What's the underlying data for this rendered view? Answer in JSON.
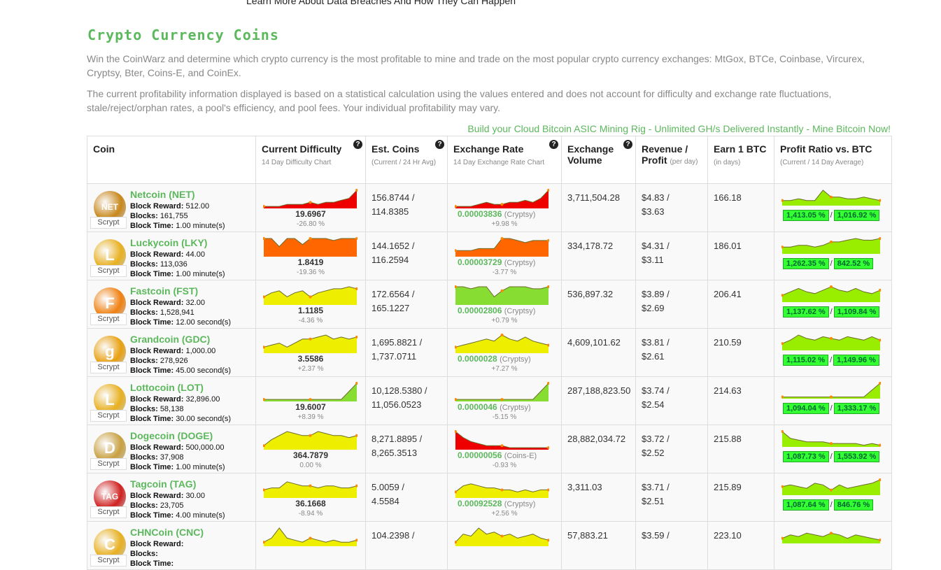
{
  "top_note": "Learn More About Data Breaches And How They Can Happen",
  "page_title": "Crypto Currency Coins",
  "intro1": "Win the CoinWarz and determine which crypto currency is the most profitable to mine and trade on the most popular crypto currency exchanges: MtGox, BTCe, Coinbase, Vircurex, Cryptsy, Bter, Coins-E, and CoinEx.",
  "intro2": "The current profitability information displayed is based on a statistical calculation using the values entered and does not account for difficulty and exchange rate fluctuations, stale/reject/orphan rates, a pool's efficiency, and pool fees. Your individual profitability may vary.",
  "promo_link": "Build your Cloud Bitcoin ASIC Mining Rig - Unlimited GH/s Delivered Instantly - Mine Bitcoin Now!",
  "headers": {
    "coin": "Coin",
    "difficulty": "Current Difficulty",
    "difficulty_sub": "14 Day Difficulty Chart",
    "est": "Est. Coins",
    "est_sub": "(Current / 24 Hr Avg)",
    "rate": "Exchange Rate",
    "rate_sub": "14 Day Exchange Rate Chart",
    "volume": "Exchange Volume",
    "revenue": "Revenue / Profit",
    "revenue_sub": "(per day)",
    "earn": "Earn 1 BTC",
    "earn_sub": "(in days)",
    "ratio": "Profit Ratio vs. BTC",
    "ratio_sub": "(Current / 14 Day Average)",
    "help": "?"
  },
  "labels": {
    "block_reward": "Block Reward:",
    "blocks": "Blocks:",
    "block_time": "Block Time:",
    "slash": "/"
  },
  "coins": [
    {
      "name": "Netcoin (NET)",
      "reward": "512.00",
      "blocks": "161,755",
      "time": "1.00 minute(s)",
      "algo": "Scrypt",
      "logo_color": "#c8871a",
      "logo_char": "NET",
      "difficulty": "19.6967",
      "diff_pct": "-26.80 %",
      "est_cur": "156.8744 /",
      "est_avg": "114.8385",
      "rate": "0.00003836",
      "exchange": "(Cryptsy)",
      "rate_pct": "+9.98 %",
      "volume": "3,711,504.28",
      "revenue": "$4.83 /",
      "profit": "$3.63",
      "earn": "166.18",
      "ratio_cur": "1,413.05 %",
      "ratio_avg": "1,016.92 %",
      "diff_color": "#e00",
      "rate_color": "#e00",
      "diff_shape": [
        1,
        1,
        1,
        2,
        2,
        2,
        3,
        2,
        3,
        3,
        4,
        5,
        9
      ],
      "rate_shape": [
        1,
        1,
        1,
        2,
        3,
        2,
        2,
        3,
        3,
        4,
        3,
        5,
        9
      ],
      "ratio_shape": [
        3,
        3,
        4,
        3,
        3,
        9,
        5,
        5,
        4,
        4,
        5,
        4,
        3
      ]
    },
    {
      "name": "Luckycoin (LKY)",
      "reward": "44.00",
      "blocks": "113,036",
      "time": "1.00 minute(s)",
      "algo": "Scrypt",
      "logo_color": "#e8b020",
      "logo_char": "L",
      "difficulty": "1.8419",
      "diff_pct": "-19.36 %",
      "est_cur": "144.1652 /",
      "est_avg": "116.2594",
      "rate": "0.00003729",
      "exchange": "(Cryptsy)",
      "rate_pct": "-3.77 %",
      "volume": "334,178.72",
      "revenue": "$4.31 /",
      "profit": "$3.11",
      "earn": "186.01",
      "ratio_cur": "1,262.35 %",
      "ratio_avg": "842.52 %",
      "diff_color": "#f60",
      "rate_color": "#f60",
      "diff_shape": [
        9,
        9,
        5,
        9,
        9,
        6,
        9,
        9,
        9,
        8,
        9,
        9,
        9
      ],
      "rate_shape": [
        3,
        3,
        3,
        4,
        4,
        4,
        9,
        9,
        8,
        7,
        8,
        8,
        8
      ],
      "ratio_shape": [
        4,
        4,
        5,
        5,
        4,
        5,
        7,
        7,
        8,
        9,
        8,
        8,
        9
      ]
    },
    {
      "name": "Fastcoin (FST)",
      "reward": "32.00",
      "blocks": "1,528,941",
      "time": "12.00 second(s)",
      "algo": "Scrypt",
      "logo_color": "#f08010",
      "logo_char": "F",
      "difficulty": "1.1185",
      "diff_pct": "-4.36 %",
      "est_cur": "172.6564 /",
      "est_avg": "165.1227",
      "rate": "0.00002806",
      "exchange": "(Cryptsy)",
      "rate_pct": "+0.79 %",
      "volume": "536,897.32",
      "revenue": "$3.89 /",
      "profit": "$2.69",
      "earn": "206.41",
      "ratio_cur": "1,137.62 %",
      "ratio_avg": "1,109.84 %",
      "diff_color": "#ee0",
      "rate_color": "#8d3",
      "diff_shape": [
        4,
        6,
        7,
        4,
        6,
        7,
        4,
        6,
        7,
        8,
        8,
        9,
        8
      ],
      "rate_shape": [
        9,
        9,
        8,
        9,
        9,
        4,
        7,
        9,
        9,
        9,
        8,
        8,
        9
      ],
      "ratio_shape": [
        4,
        6,
        8,
        6,
        5,
        7,
        9,
        7,
        6,
        8,
        6,
        5,
        7
      ]
    },
    {
      "name": "Grandcoin (GDC)",
      "reward": "1,000.00",
      "blocks": "278,926",
      "time": "45.00 second(s)",
      "algo": "Scrypt",
      "logo_color": "#e8a010",
      "logo_char": "g",
      "difficulty": "3.5586",
      "diff_pct": "+2.37 %",
      "est_cur": "1,695.8821 /",
      "est_avg": "1,737.0711",
      "rate": "0.0000028",
      "exchange": "(Cryptsy)",
      "rate_pct": "+7.27 %",
      "volume": "4,609,101.62",
      "revenue": "$3.81 /",
      "profit": "$2.61",
      "earn": "210.59",
      "ratio_cur": "1,115.02 %",
      "ratio_avg": "1,149.96 %",
      "diff_color": "#ee0",
      "rate_color": "#ee0",
      "diff_shape": [
        3,
        4,
        5,
        3,
        5,
        7,
        7,
        8,
        9,
        7,
        8,
        7,
        8
      ],
      "rate_shape": [
        3,
        4,
        5,
        6,
        7,
        6,
        9,
        7,
        6,
        8,
        6,
        5,
        4
      ],
      "ratio_shape": [
        4,
        6,
        9,
        7,
        6,
        8,
        7,
        6,
        8,
        7,
        6,
        8,
        6
      ]
    },
    {
      "name": "Lottocoin (LOT)",
      "reward": "32,896.00",
      "blocks": "58,138",
      "time": "30.00 second(s)",
      "algo": "Scrypt",
      "logo_color": "#e8b020",
      "logo_char": "L",
      "difficulty": "19.6007",
      "diff_pct": "+8.39 %",
      "est_cur": "10,128.5380 /",
      "est_avg": "11,056.0523",
      "rate": "0.0000046",
      "exchange": "(Cryptsy)",
      "rate_pct": "-5.15 %",
      "volume": "287,188,823.50",
      "revenue": "$3.74 /",
      "profit": "$2.54",
      "earn": "214.63",
      "ratio_cur": "1,094.04 %",
      "ratio_avg": "1,333.17 %",
      "diff_color": "#8d3",
      "rate_color": "#8d3",
      "diff_shape": [
        1,
        1,
        1,
        1,
        1,
        1,
        1,
        1,
        1,
        1,
        1,
        5,
        9
      ],
      "rate_shape": [
        1,
        1,
        1,
        1,
        1,
        1,
        1,
        1,
        1,
        1,
        1,
        5,
        9
      ],
      "ratio_shape": [
        1,
        1,
        1,
        1,
        1,
        1,
        1,
        1,
        1,
        1,
        1,
        5,
        9
      ]
    },
    {
      "name": "Dogecoin (DOGE)",
      "reward": "500,000.00",
      "blocks": "37,908",
      "time": "1.00 minute(s)",
      "algo": "Scrypt",
      "logo_color": "#c8a040",
      "logo_char": "D",
      "difficulty": "364.7879",
      "diff_pct": "0.00 %",
      "est_cur": "8,271.8895 /",
      "est_avg": "8,265.3513",
      "rate": "0.00000056",
      "exchange": "(Coins-E)",
      "rate_pct": "-0.93 %",
      "volume": "28,882,034.72",
      "revenue": "$3.72 /",
      "profit": "$2.52",
      "earn": "215.88",
      "ratio_cur": "1,087.73 %",
      "ratio_avg": "1,553.92 %",
      "diff_color": "#ee0",
      "rate_color": "#e00",
      "diff_shape": [
        2,
        5,
        7,
        9,
        8,
        7,
        7,
        9,
        8,
        7,
        7,
        6,
        7
      ],
      "rate_shape": [
        9,
        6,
        4,
        3,
        2,
        2,
        2,
        1,
        1,
        1,
        1,
        1,
        1
      ],
      "ratio_shape": [
        9,
        5,
        4,
        3,
        3,
        3,
        2,
        2,
        2,
        2,
        1,
        2,
        1
      ]
    },
    {
      "name": "Tagcoin (TAG)",
      "reward": "30.00",
      "blocks": "23,705",
      "time": "4.00 minute(s)",
      "algo": "Scrypt",
      "logo_color": "#d02020",
      "logo_char": "TAG",
      "difficulty": "36.1668",
      "diff_pct": "-8.94 %",
      "est_cur": "5.0059 /",
      "est_avg": "4.5584",
      "rate": "0.00092528",
      "exchange": "(Cryptsy)",
      "rate_pct": "+2.56 %",
      "volume": "3,311.03",
      "revenue": "$3.71 /",
      "profit": "$2.51",
      "earn": "215.89",
      "ratio_cur": "1,087.64 %",
      "ratio_avg": "846.76 %",
      "diff_color": "#ee0",
      "rate_color": "#ee0",
      "diff_shape": [
        4,
        5,
        5,
        8,
        7,
        6,
        6,
        5,
        6,
        6,
        5,
        5,
        6
      ],
      "rate_shape": [
        3,
        6,
        7,
        6,
        5,
        5,
        4,
        4,
        3,
        4,
        3,
        4,
        4
      ],
      "ratio_shape": [
        5,
        6,
        5,
        4,
        7,
        6,
        3,
        6,
        4,
        5,
        6,
        7,
        9
      ]
    },
    {
      "name": "CHNCoin (CNC)",
      "reward": "",
      "blocks": "",
      "time": "",
      "algo": "Scrypt",
      "logo_color": "#e8b020",
      "logo_char": "C",
      "difficulty": "",
      "diff_pct": "",
      "est_cur": "104.2398 /",
      "est_avg": "",
      "rate": "",
      "exchange": "",
      "rate_pct": "",
      "volume": "57,883.21",
      "revenue": "$3.59 /",
      "profit": "",
      "earn": "223.10",
      "ratio_cur": "",
      "ratio_avg": "",
      "diff_color": "#ee0",
      "rate_color": "#ee0",
      "diff_shape": [
        2,
        4,
        9,
        4,
        3,
        2,
        4,
        3,
        2,
        3,
        2,
        2,
        3
      ],
      "rate_shape": [
        2,
        6,
        5,
        9,
        6,
        7,
        5,
        6,
        4,
        5,
        6,
        4,
        3
      ],
      "ratio_shape": [
        3,
        5,
        4,
        6,
        5,
        4,
        6,
        5,
        3,
        5,
        4,
        3,
        2
      ]
    }
  ]
}
